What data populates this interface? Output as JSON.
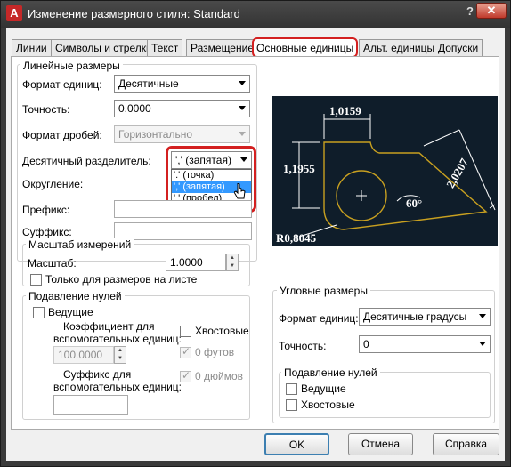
{
  "window": {
    "title": "Изменение размерного стиля: Standard",
    "app_icon": "A",
    "help": "?",
    "close": "✕"
  },
  "tabs": [
    "Линии",
    "Символы и стрелки",
    "Текст",
    "Размещение",
    "Основные единицы",
    "Альт. единицы",
    "Допуски"
  ],
  "linear": {
    "group": "Линейные размеры",
    "unit_format_label": "Формат единиц:",
    "unit_format_value": "Десятичные",
    "precision_label": "Точность:",
    "precision_value": "0.0000",
    "fraction_label": "Формат дробей:",
    "fraction_value": "Горизонтально",
    "decimal_sep_label": "Десятичный  разделитель:",
    "decimal_sep_value": "',' (запятая)",
    "decimal_sep_options": [
      "'.' (точка)",
      "',' (запятая)",
      "' ' (пробел)"
    ],
    "roundoff_label": "Округление:",
    "prefix_label": "Префикс:",
    "suffix_label": "Суффикс:"
  },
  "scale": {
    "group": "Масштаб измерений",
    "scale_label": "Масштаб:",
    "scale_value": "1.0000",
    "layout_only_label": "Только для размеров на листе"
  },
  "zero_suppression": {
    "group": "Подавление нулей",
    "leading": "Ведущие",
    "sub_units_factor_label_1": "Коэффициент для",
    "sub_units_factor_label_2": "вспомогательных единиц:",
    "sub_units_factor_value": "100.0000",
    "trailing": "Хвостовые",
    "feet": "0 футов",
    "inches": "0 дюймов",
    "sub_units_suffix_label_1": "Суффикс для",
    "sub_units_suffix_label_2": "вспомогательных единиц:"
  },
  "angular": {
    "group": "Угловые размеры",
    "unit_format_label": "Формат единиц:",
    "unit_format_value": "Десятичные градусы",
    "precision_label": "Точность:",
    "precision_value": "0",
    "zero_group": "Подавление нулей",
    "leading": "Ведущие",
    "trailing": "Хвостовые"
  },
  "preview": {
    "dim_top": "1,0159",
    "dim_left": "1,1955",
    "dim_right": "2,0207",
    "dim_angle": "60°",
    "dim_radius": "R0,8045"
  },
  "buttons": {
    "ok": "OK",
    "cancel": "Отмена",
    "help": "Справка"
  },
  "colors": {
    "highlight": "#d32020",
    "selection": "#3399ff",
    "preview_bg": "#0f1d2a",
    "geometry": "#c8a020"
  }
}
